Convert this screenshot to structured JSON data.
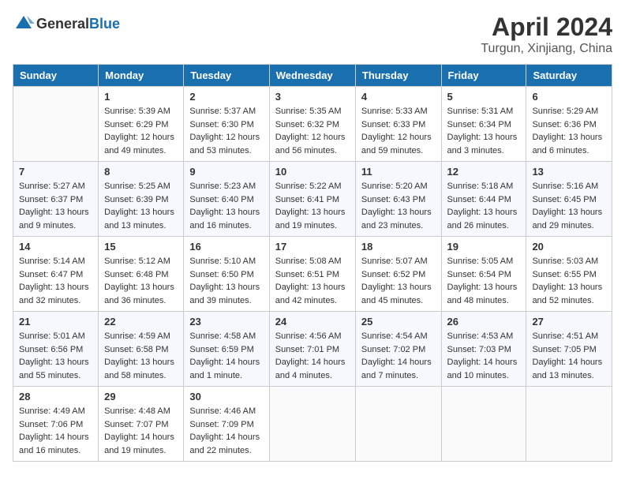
{
  "header": {
    "logo_general": "General",
    "logo_blue": "Blue",
    "month": "April 2024",
    "location": "Turgun, Xinjiang, China"
  },
  "days_of_week": [
    "Sunday",
    "Monday",
    "Tuesday",
    "Wednesday",
    "Thursday",
    "Friday",
    "Saturday"
  ],
  "weeks": [
    [
      {
        "day": "",
        "content": ""
      },
      {
        "day": "1",
        "content": "Sunrise: 5:39 AM\nSunset: 6:29 PM\nDaylight: 12 hours\nand 49 minutes."
      },
      {
        "day": "2",
        "content": "Sunrise: 5:37 AM\nSunset: 6:30 PM\nDaylight: 12 hours\nand 53 minutes."
      },
      {
        "day": "3",
        "content": "Sunrise: 5:35 AM\nSunset: 6:32 PM\nDaylight: 12 hours\nand 56 minutes."
      },
      {
        "day": "4",
        "content": "Sunrise: 5:33 AM\nSunset: 6:33 PM\nDaylight: 12 hours\nand 59 minutes."
      },
      {
        "day": "5",
        "content": "Sunrise: 5:31 AM\nSunset: 6:34 PM\nDaylight: 13 hours\nand 3 minutes."
      },
      {
        "day": "6",
        "content": "Sunrise: 5:29 AM\nSunset: 6:36 PM\nDaylight: 13 hours\nand 6 minutes."
      }
    ],
    [
      {
        "day": "7",
        "content": "Sunrise: 5:27 AM\nSunset: 6:37 PM\nDaylight: 13 hours\nand 9 minutes."
      },
      {
        "day": "8",
        "content": "Sunrise: 5:25 AM\nSunset: 6:39 PM\nDaylight: 13 hours\nand 13 minutes."
      },
      {
        "day": "9",
        "content": "Sunrise: 5:23 AM\nSunset: 6:40 PM\nDaylight: 13 hours\nand 16 minutes."
      },
      {
        "day": "10",
        "content": "Sunrise: 5:22 AM\nSunset: 6:41 PM\nDaylight: 13 hours\nand 19 minutes."
      },
      {
        "day": "11",
        "content": "Sunrise: 5:20 AM\nSunset: 6:43 PM\nDaylight: 13 hours\nand 23 minutes."
      },
      {
        "day": "12",
        "content": "Sunrise: 5:18 AM\nSunset: 6:44 PM\nDaylight: 13 hours\nand 26 minutes."
      },
      {
        "day": "13",
        "content": "Sunrise: 5:16 AM\nSunset: 6:45 PM\nDaylight: 13 hours\nand 29 minutes."
      }
    ],
    [
      {
        "day": "14",
        "content": "Sunrise: 5:14 AM\nSunset: 6:47 PM\nDaylight: 13 hours\nand 32 minutes."
      },
      {
        "day": "15",
        "content": "Sunrise: 5:12 AM\nSunset: 6:48 PM\nDaylight: 13 hours\nand 36 minutes."
      },
      {
        "day": "16",
        "content": "Sunrise: 5:10 AM\nSunset: 6:50 PM\nDaylight: 13 hours\nand 39 minutes."
      },
      {
        "day": "17",
        "content": "Sunrise: 5:08 AM\nSunset: 6:51 PM\nDaylight: 13 hours\nand 42 minutes."
      },
      {
        "day": "18",
        "content": "Sunrise: 5:07 AM\nSunset: 6:52 PM\nDaylight: 13 hours\nand 45 minutes."
      },
      {
        "day": "19",
        "content": "Sunrise: 5:05 AM\nSunset: 6:54 PM\nDaylight: 13 hours\nand 48 minutes."
      },
      {
        "day": "20",
        "content": "Sunrise: 5:03 AM\nSunset: 6:55 PM\nDaylight: 13 hours\nand 52 minutes."
      }
    ],
    [
      {
        "day": "21",
        "content": "Sunrise: 5:01 AM\nSunset: 6:56 PM\nDaylight: 13 hours\nand 55 minutes."
      },
      {
        "day": "22",
        "content": "Sunrise: 4:59 AM\nSunset: 6:58 PM\nDaylight: 13 hours\nand 58 minutes."
      },
      {
        "day": "23",
        "content": "Sunrise: 4:58 AM\nSunset: 6:59 PM\nDaylight: 14 hours\nand 1 minute."
      },
      {
        "day": "24",
        "content": "Sunrise: 4:56 AM\nSunset: 7:01 PM\nDaylight: 14 hours\nand 4 minutes."
      },
      {
        "day": "25",
        "content": "Sunrise: 4:54 AM\nSunset: 7:02 PM\nDaylight: 14 hours\nand 7 minutes."
      },
      {
        "day": "26",
        "content": "Sunrise: 4:53 AM\nSunset: 7:03 PM\nDaylight: 14 hours\nand 10 minutes."
      },
      {
        "day": "27",
        "content": "Sunrise: 4:51 AM\nSunset: 7:05 PM\nDaylight: 14 hours\nand 13 minutes."
      }
    ],
    [
      {
        "day": "28",
        "content": "Sunrise: 4:49 AM\nSunset: 7:06 PM\nDaylight: 14 hours\nand 16 minutes."
      },
      {
        "day": "29",
        "content": "Sunrise: 4:48 AM\nSunset: 7:07 PM\nDaylight: 14 hours\nand 19 minutes."
      },
      {
        "day": "30",
        "content": "Sunrise: 4:46 AM\nSunset: 7:09 PM\nDaylight: 14 hours\nand 22 minutes."
      },
      {
        "day": "",
        "content": ""
      },
      {
        "day": "",
        "content": ""
      },
      {
        "day": "",
        "content": ""
      },
      {
        "day": "",
        "content": ""
      }
    ]
  ]
}
